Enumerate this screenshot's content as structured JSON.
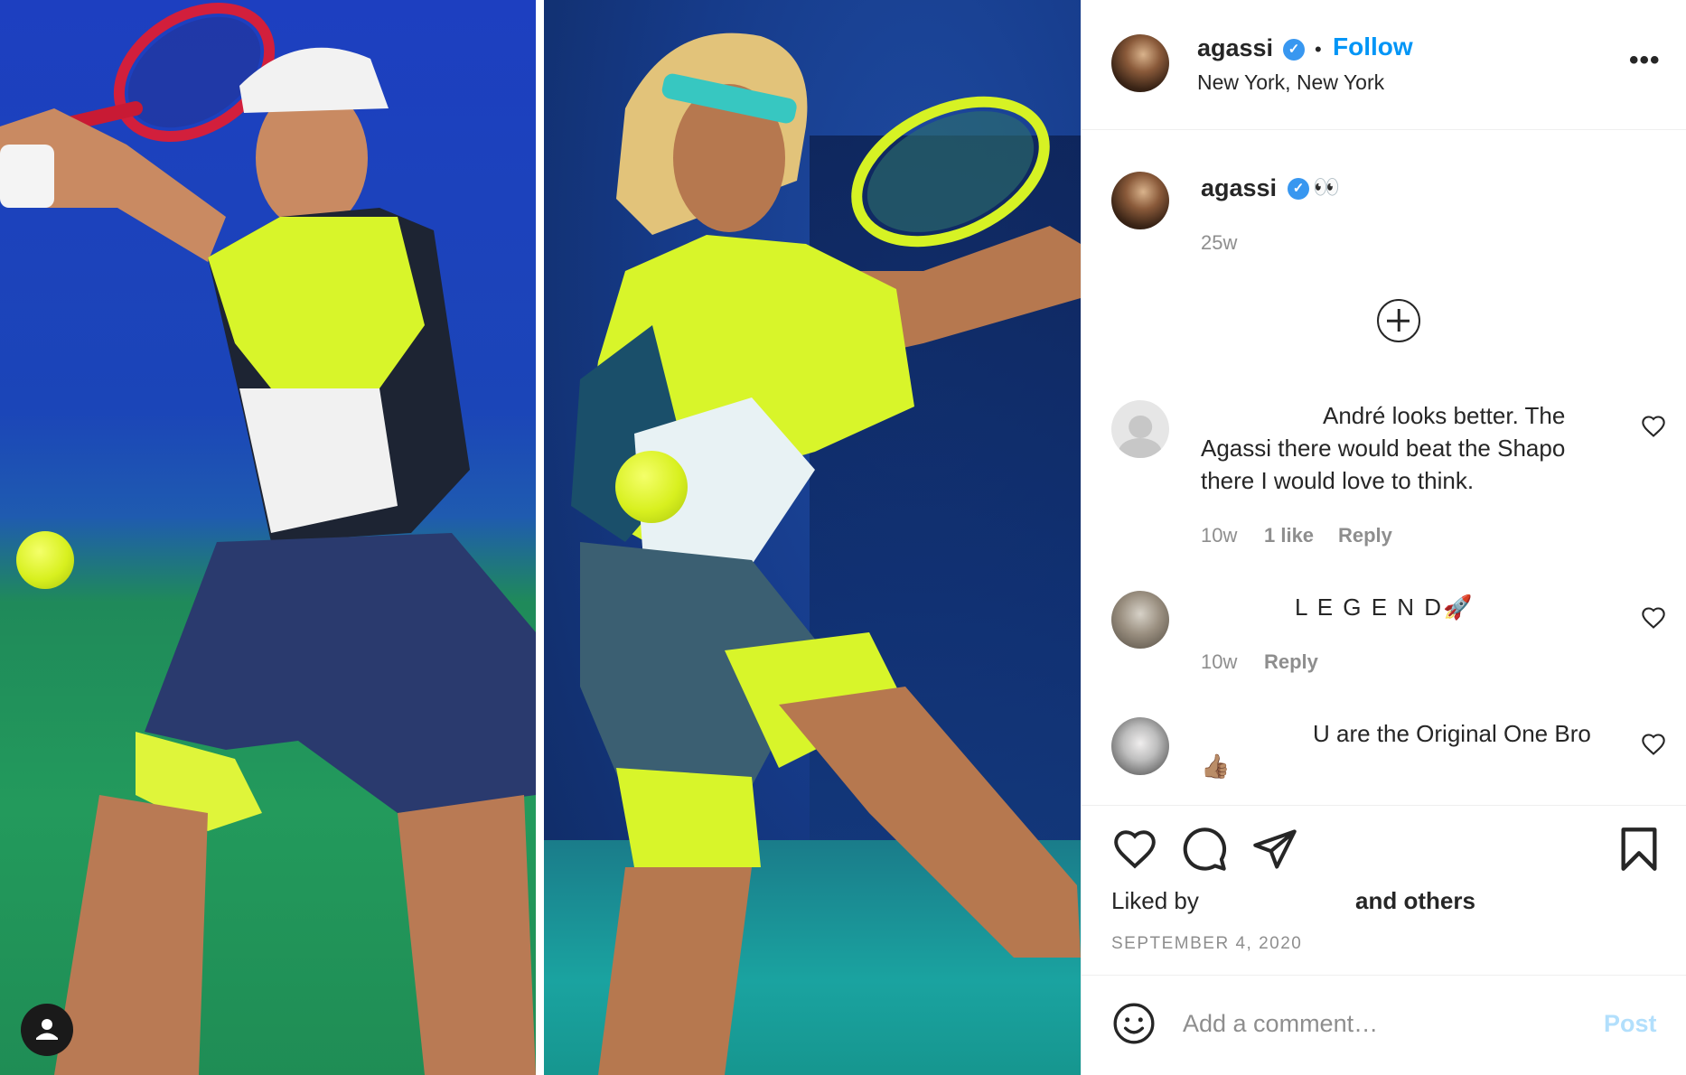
{
  "post": {
    "author": "agassi",
    "follow_label": "Follow",
    "location": "New York, New York",
    "more_label": "•••",
    "separator": "•"
  },
  "caption": {
    "username": "agassi",
    "text": "👀",
    "time": "25w"
  },
  "comments": [
    {
      "text": "André looks better. The Agassi there would beat the Shapo there I would love to think.",
      "time": "10w",
      "likes": "1 like",
      "reply": "Reply"
    },
    {
      "text": "L E G E N D🚀",
      "time": "10w",
      "reply": "Reply"
    },
    {
      "text": "U are the Original One Bro 👍🏽"
    }
  ],
  "likes": {
    "prefix": "Liked by",
    "suffix": "and others"
  },
  "date": "SEPTEMBER 4, 2020",
  "comment_input": {
    "placeholder": "Add a comment…",
    "post_label": "Post"
  },
  "colors": {
    "accent": "#0095f6",
    "verified": "#3897f0",
    "post_disabled": "#b2dffc"
  }
}
